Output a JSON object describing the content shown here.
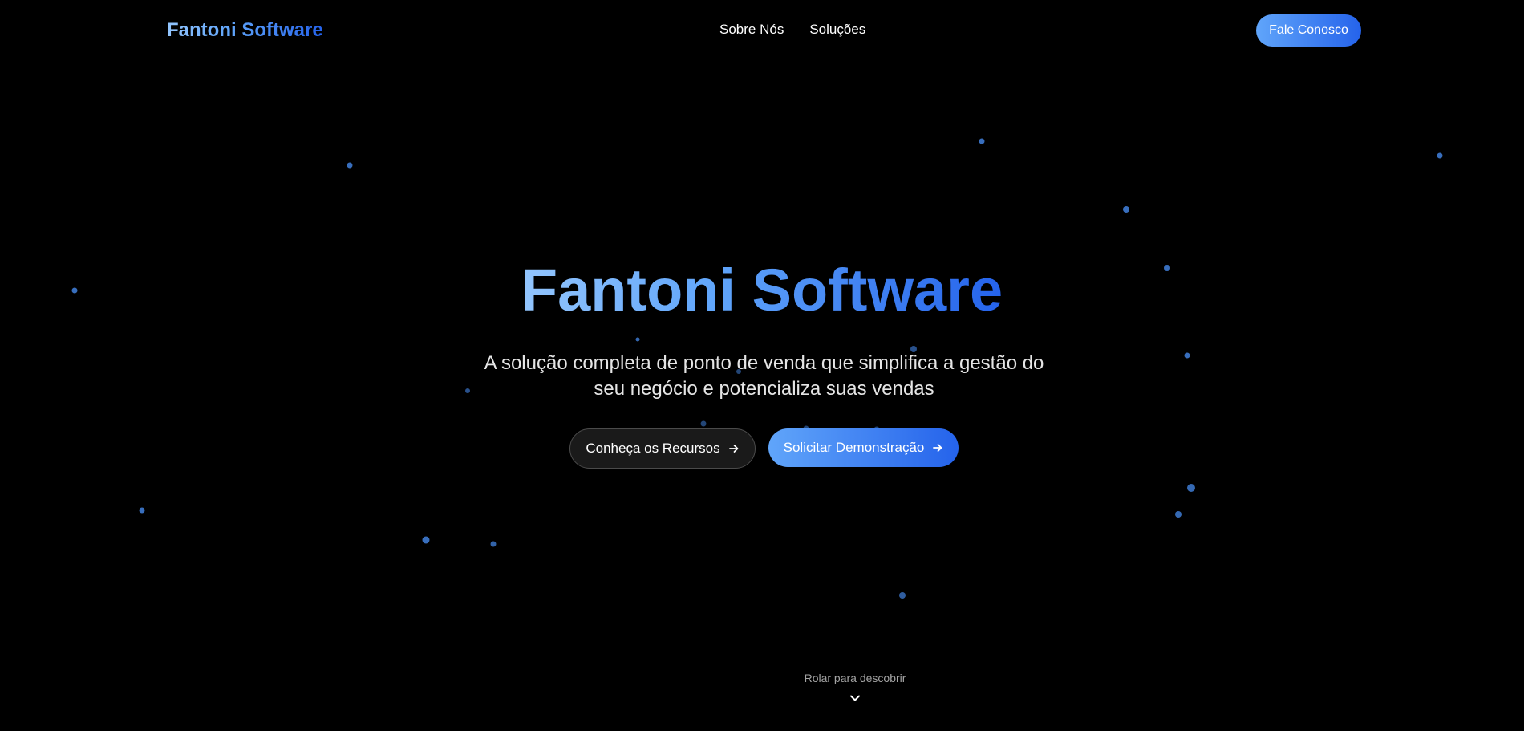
{
  "header": {
    "logo": "Fantoni Software",
    "nav": [
      {
        "label": "Sobre Nós"
      },
      {
        "label": "Soluções"
      }
    ],
    "contact_label": "Fale Conosco"
  },
  "hero": {
    "title": "Fantoni Software",
    "subtitle": "A solução completa de ponto de venda que simplifica a gestão do seu negócio e potencializa suas vendas",
    "primary_cta": "Solicitar Demonstração",
    "secondary_cta": "Conheça os Recursos"
  },
  "scroll_hint": {
    "label": "Rolar para descobrir",
    "icon": "chevron-down-icon"
  },
  "icons": {
    "cta_arrow": "arrow-right-icon",
    "particle": "particle-dot"
  },
  "colors": {
    "background": "#000000",
    "accent_start": "#60a5fa",
    "accent_end": "#2563eb",
    "particle": "#3b74c7"
  }
}
